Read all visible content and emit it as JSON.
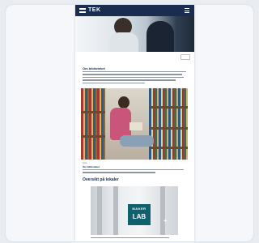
{
  "header": {
    "logo_text": "TEK",
    "menu_icon": "hamburger-menu-icon"
  },
  "intro": {
    "title": "Om biblioteket"
  },
  "feature": {
    "caption_small": "Foto",
    "caption_title": "Om biblioteket"
  },
  "section": {
    "title": "Oversikt på lokaler"
  },
  "lab_sign": {
    "top": "MAKER",
    "main": "LAB",
    "plus": "+"
  },
  "colors": {
    "header_bg": "#1a2c4f",
    "accent_title": "#1a2c4f",
    "lab_sign": "#11606e"
  }
}
